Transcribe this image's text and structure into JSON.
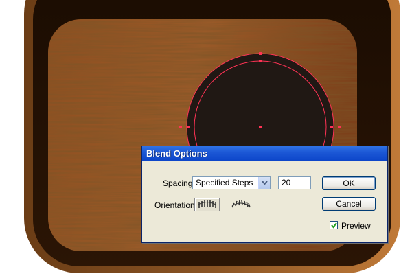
{
  "dialog": {
    "title": "Blend Options",
    "spacing_label": "Spacing:",
    "spacing_value": "Specified Steps",
    "steps_value": "20",
    "orientation_label": "Orientation:",
    "ok_label": "OK",
    "cancel_label": "Cancel",
    "preview_label": "Preview",
    "preview_checked": true
  },
  "artwork": {
    "frame_color": "#3a1e08",
    "wood_color": "#8a4a1c",
    "circle_fill": "#201814",
    "selection_color": "#ff3355"
  }
}
